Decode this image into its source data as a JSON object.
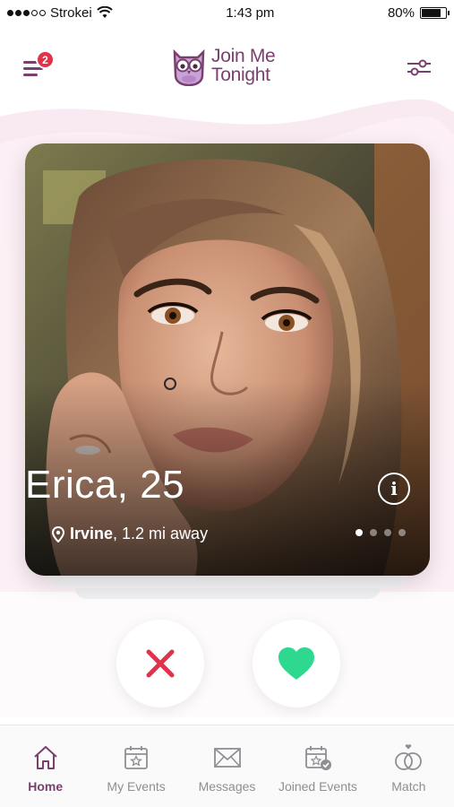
{
  "status_bar": {
    "carrier": "Strokei",
    "time": "1:43 pm",
    "battery": "80%",
    "battery_level": 0.8
  },
  "header": {
    "notification_count": "2",
    "logo_line1": "Join Me",
    "logo_line2": "Tonight"
  },
  "profile": {
    "name_age": "Erica, 25",
    "city": "Irvine",
    "distance": ", 1.2 mi away",
    "info_label": "i",
    "photo_count": 4,
    "active_photo": 1
  },
  "actions": {
    "nope_icon": "x-icon",
    "like_icon": "heart-icon"
  },
  "tabs": [
    {
      "label": "Home",
      "icon": "home-icon",
      "active": true
    },
    {
      "label": "My Events",
      "icon": "calendar-star-icon",
      "active": false
    },
    {
      "label": "Messages",
      "icon": "envelope-icon",
      "active": false
    },
    {
      "label": "Joined Events",
      "icon": "calendar-check-icon",
      "active": false
    },
    {
      "label": "Match",
      "icon": "rings-icon",
      "active": false
    }
  ],
  "colors": {
    "brand": "#7a3f6e",
    "badge": "#e0334a",
    "nope": "#e0334a",
    "like": "#2ed98f"
  }
}
